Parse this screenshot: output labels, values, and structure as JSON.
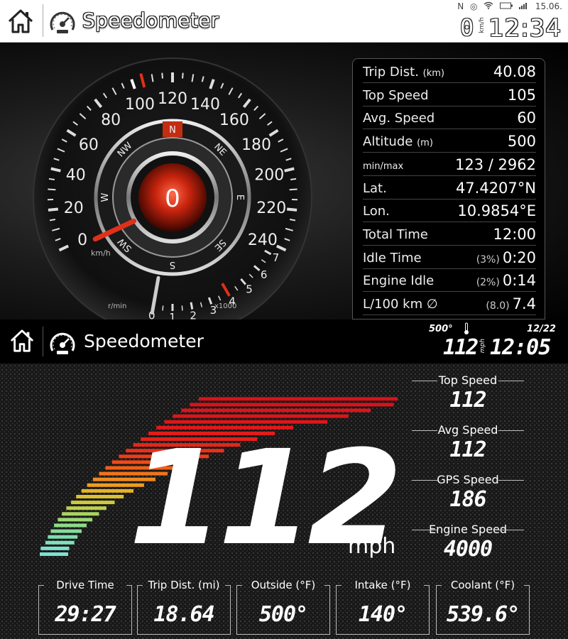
{
  "screen1": {
    "header": {
      "title": "Speedometer",
      "status": {
        "indicator": "N",
        "date": "15.06.",
        "battery_icon": "battery-icon",
        "signal_icon": "signal-icon",
        "wifi_icon": "wifi-icon"
      },
      "speed_small": "0",
      "speed_unit": "km/h",
      "time": "12:34"
    },
    "dial": {
      "speed_ticks": [
        "0",
        "20",
        "40",
        "60",
        "80",
        "100",
        "120",
        "140",
        "160",
        "180",
        "200",
        "220",
        "240"
      ],
      "unit": "km/h",
      "current_speed": "0",
      "compass": [
        "N",
        "NE",
        "E",
        "SE",
        "S",
        "SW",
        "W",
        "NW"
      ],
      "rpm_ticks": [
        "0",
        "1",
        "2",
        "3",
        "4",
        "5",
        "6",
        "7"
      ],
      "rpm_unit": "r/min",
      "rpm_multiplier": "x1000",
      "speed_value": 0,
      "max_speed_marker": 105,
      "rpm_value": 0,
      "rpm_redline": 4
    },
    "stats": [
      {
        "label": "Trip Dist.",
        "sub": "(km)",
        "value": "40.08",
        "pct": ""
      },
      {
        "label": "Top Speed",
        "sub": "",
        "value": "105",
        "pct": ""
      },
      {
        "label": "Avg. Speed",
        "sub": "",
        "value": "60",
        "pct": ""
      },
      {
        "label": "Altitude",
        "sub": "(m)",
        "value": "500",
        "pct": ""
      },
      {
        "label": "min/max",
        "sub": "",
        "value": "123 / 2962",
        "pct": ""
      },
      {
        "label": "Lat.",
        "sub": "",
        "value": "47.4207°N",
        "pct": ""
      },
      {
        "label": "Lon.",
        "sub": "",
        "value": "10.9854°E",
        "pct": ""
      },
      {
        "label": "Total Time",
        "sub": "",
        "value": "12:00",
        "pct": ""
      },
      {
        "label": "Idle Time",
        "sub": "",
        "value": "0:20",
        "pct": "(3%)"
      },
      {
        "label": "Engine Idle",
        "sub": "",
        "value": "0:14",
        "pct": "(2%)"
      },
      {
        "label": "L/100 km ∅",
        "sub": "",
        "value": "7.4",
        "pct": "(8.0)"
      }
    ]
  },
  "screen2": {
    "header": {
      "title": "Speedometer",
      "temp": "500°",
      "date": "12/22",
      "speed_small": "112",
      "speed_unit": "mph",
      "time": "12:05"
    },
    "speed": "112",
    "unit": "mph",
    "speed_bar_level": 1.0,
    "side_stats": [
      {
        "label": "Top Speed",
        "value": "112"
      },
      {
        "label": "Avg Speed",
        "value": "112"
      },
      {
        "label": "GPS Speed",
        "value": "186"
      },
      {
        "label": "Engine Speed",
        "value": "4000"
      }
    ],
    "bottom_stats": [
      {
        "label": "Drive Time",
        "value": "29:27"
      },
      {
        "label": "Trip Dist. (mi)",
        "value": "18.64"
      },
      {
        "label": "Outside (°F)",
        "value": "500°"
      },
      {
        "label": "Intake (°F)",
        "value": "140°"
      },
      {
        "label": "Coolant (°F)",
        "value": "539.6°"
      }
    ]
  }
}
